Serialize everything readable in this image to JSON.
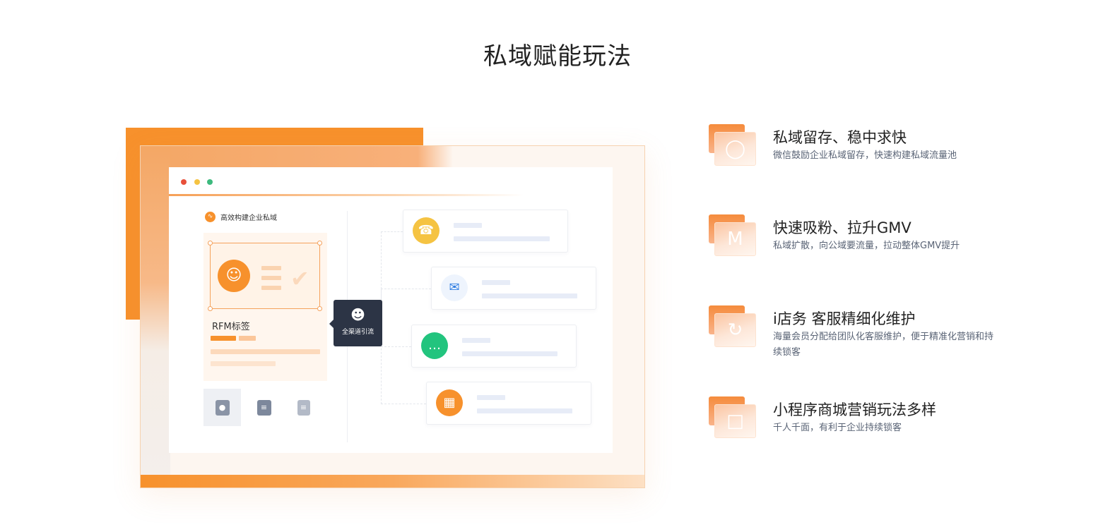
{
  "page_title": "私域赋能玩法",
  "illustration": {
    "brand_label": "高效构建企业私域",
    "card_label": "RFM标签",
    "hub_label": "全渠道引流",
    "icons": {
      "brand": "waveform-icon",
      "people": "people-group-icon",
      "check": "check-icon",
      "tools": [
        "contact-card-icon",
        "chat-search-icon",
        "document-icon"
      ],
      "hub": "add-user-icon",
      "channels": [
        "phone-icon",
        "chat-bubble-icon",
        "message-icon",
        "qr-code-icon"
      ]
    },
    "colors": {
      "accent_orange": "#f7912c",
      "phone": "#f5c342",
      "chat": "#2f7de1",
      "message": "#22c47e",
      "qr": "#f7912c",
      "hub_bg": "#2c3445"
    }
  },
  "features": [
    {
      "title": "私域留存、稳中求快",
      "desc": "微信鼓励企业私域留存，快速构建私域流量池",
      "icon": "search-bubble-icon"
    },
    {
      "title": "快速吸粉、拉升GMV",
      "desc": "私域扩散，向公域要流量，拉动整体GMV提升",
      "icon": "m-logo-icon"
    },
    {
      "title": "i店务 客服精细化维护",
      "desc": "海量会员分配给团队化客服维护，便于精准化营销和持续锁客",
      "icon": "refresh-icon"
    },
    {
      "title": "小程序商城营销玩法多样",
      "desc": "千人千面，有利于企业持续锁客",
      "icon": "shopping-bag-icon"
    }
  ]
}
